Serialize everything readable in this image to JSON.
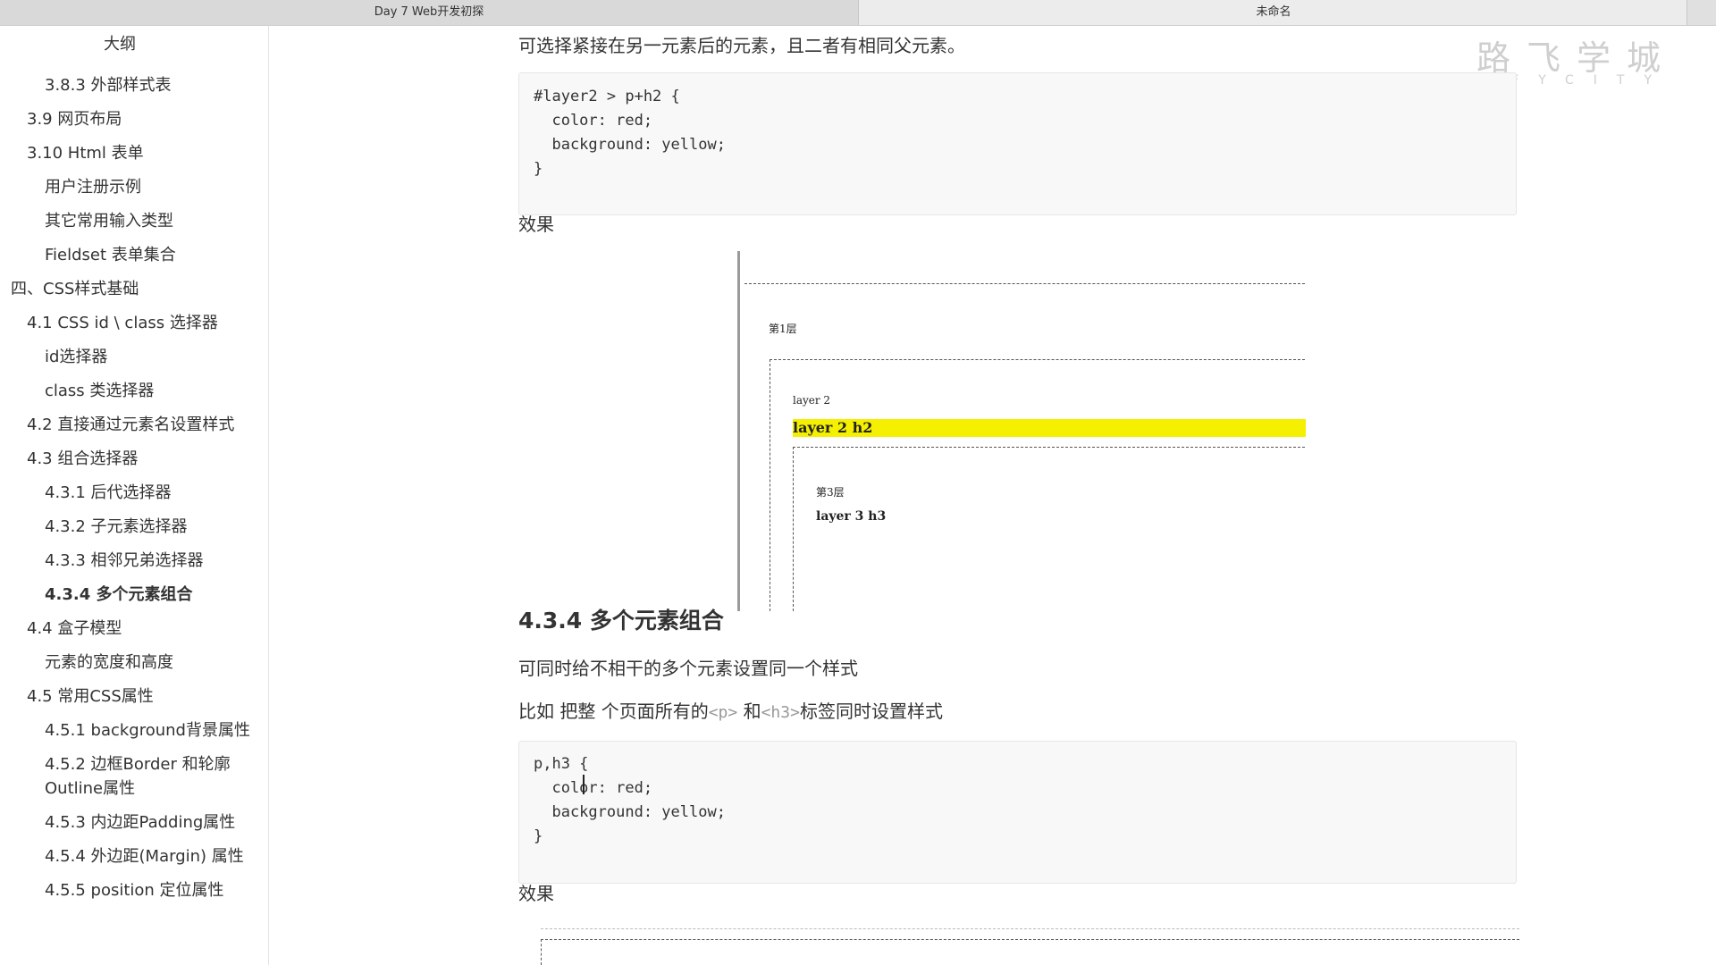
{
  "tabs": [
    {
      "label": "Day 7 Web开发初探"
    },
    {
      "label": "未命名"
    }
  ],
  "sidebar": {
    "title": "大纲",
    "items": [
      {
        "label": "3.8.3 外部样式表",
        "level": 3
      },
      {
        "label": "3.9 网页布局",
        "level": 2
      },
      {
        "label": "3.10 Html 表单",
        "level": 2
      },
      {
        "label": "用户注册示例",
        "level": 3
      },
      {
        "label": "其它常用输入类型",
        "level": 3
      },
      {
        "label": "Fieldset 表单集合",
        "level": 3
      },
      {
        "label": "四、CSS样式基础",
        "level": 1
      },
      {
        "label": "4.1 CSS id \\ class 选择器",
        "level": 2
      },
      {
        "label": "id选择器",
        "level": 3
      },
      {
        "label": "class 类选择器",
        "level": 3
      },
      {
        "label": "4.2 直接通过元素名设置样式",
        "level": 2
      },
      {
        "label": "4.3 组合选择器",
        "level": 2
      },
      {
        "label": "4.3.1 后代选择器",
        "level": 3
      },
      {
        "label": "4.3.2 子元素选择器",
        "level": 3
      },
      {
        "label": "4.3.3 相邻兄弟选择器",
        "level": 3
      },
      {
        "label": "4.3.4 多个元素组合",
        "level": 3,
        "active": true
      },
      {
        "label": "4.4 盒子模型",
        "level": 2
      },
      {
        "label": "元素的宽度和高度",
        "level": 3
      },
      {
        "label": "4.5 常用CSS属性",
        "level": 2
      },
      {
        "label": "4.5.1 background背景属性",
        "level": 3
      },
      {
        "label": "4.5.2 边框Border 和轮廓Outline属性",
        "level": 3
      },
      {
        "label": "4.5.3 内边距Padding属性",
        "level": 3
      },
      {
        "label": "4.5.4 外边距(Margin) 属性",
        "level": 3
      },
      {
        "label": "4.5.5 position 定位属性",
        "level": 3
      }
    ]
  },
  "content": {
    "intro": "可选择紧接在另一元素后的元素，且二者有相同父元素。",
    "code1": [
      "#layer2 > p+h2 {",
      "  color: red;",
      "  background: yellow;",
      "}"
    ],
    "effect_label": "效果",
    "demo1": {
      "layer1_label": "第1层",
      "layer2_label": "layer 2",
      "layer2_h2": "layer 2 h2",
      "layer3_label": "第3层",
      "layer3_h3": "layer 3 h3"
    },
    "section_heading": "4.3.4 多个元素组合",
    "desc1": "可同时给不相干的多个元素设置同一个样式",
    "desc2_prefix": "比如 把整 个页面所有的",
    "desc2_code1": "<p>",
    "desc2_mid": " 和",
    "desc2_code2": "<h3>",
    "desc2_suffix": "标签同时设置样式",
    "code2": [
      "p,h3 {",
      "  color: red;",
      "  background: yellow;",
      "}"
    ],
    "effect_label2": "效果"
  },
  "watermark": {
    "cn": "路飞学城",
    "en": "LUFFYCITY"
  },
  "colors": {
    "highlight": "#f5f000",
    "code_bg": "#f8f8f8",
    "watermark": "#cfcfcf"
  }
}
